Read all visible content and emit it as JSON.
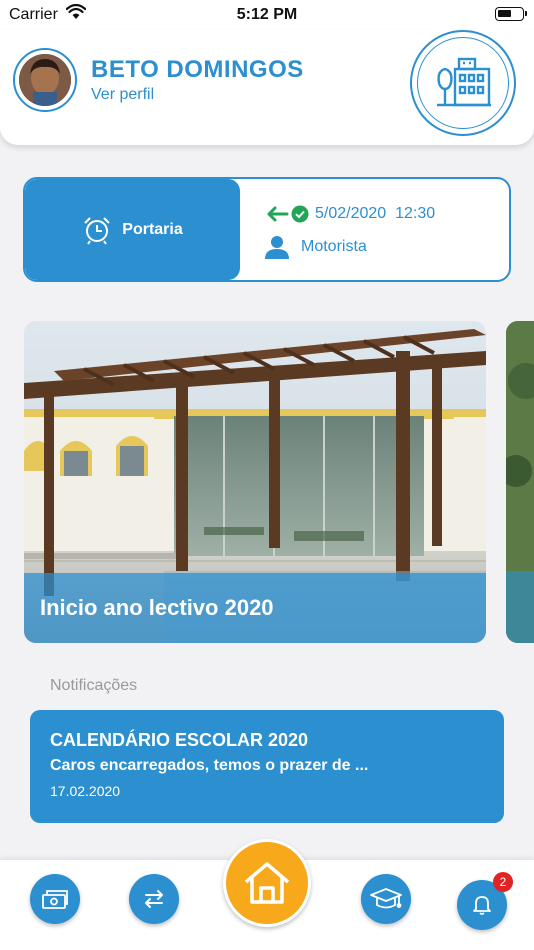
{
  "status_bar": {
    "carrier": "Carrier",
    "time": "5:12 PM"
  },
  "profile": {
    "name": "BETO DOMINGOS",
    "link": "Ver perfil"
  },
  "access": {
    "location": "Portaria",
    "datetime": "5/02/2020  12:30",
    "person_role": "Motorista"
  },
  "carousel": {
    "slides": [
      {
        "caption": "Inicio ano lectivo 2020"
      }
    ]
  },
  "notifications": {
    "title": "Notificações",
    "items": [
      {
        "title": "CALENDÁRIO ESCOLAR 2020",
        "preview": "Caros encarregados, temos o prazer de ...",
        "date": "17.02.2020"
      }
    ]
  },
  "bottom_nav": {
    "notification_count": "2"
  },
  "colors": {
    "primary": "#2b8fd0",
    "accent": "#f7a81b",
    "success": "#22a559",
    "badge": "#e02424"
  }
}
